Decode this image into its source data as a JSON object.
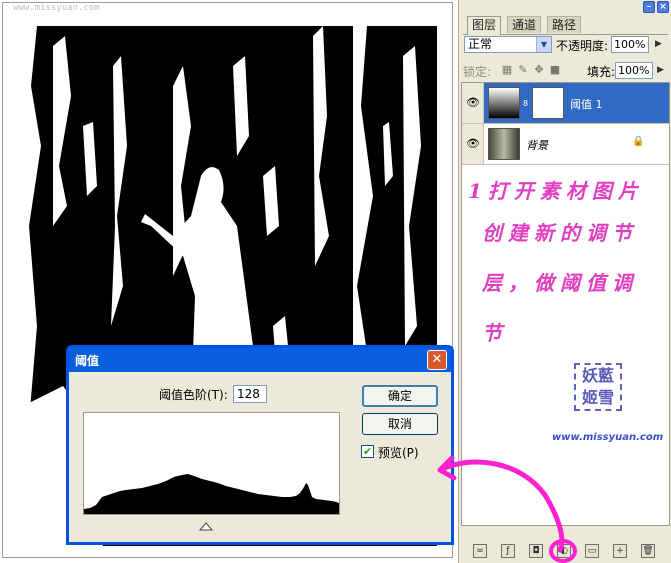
{
  "canvas": {
    "watermark": "www.missyuan.com"
  },
  "layers_panel": {
    "tabs": [
      "图层",
      "通道",
      "路径"
    ],
    "active_tab": 0,
    "blend_mode": "正常",
    "opacity_label": "不透明度:",
    "opacity_value": "100%",
    "lock_label": "锁定:",
    "fill_label": "填充:",
    "fill_value": "100%",
    "layers": [
      {
        "name": "阈值 1",
        "selected": true,
        "icon": "adjustment-layer-thumbnail"
      },
      {
        "name": "背景",
        "selected": false,
        "icon": "background-photo-thumbnail",
        "locked": true
      }
    ],
    "annotation_lines": [
      "1打开素材图片",
      "创建新的调节",
      "层，做阈值调",
      "节"
    ],
    "stamp_text": [
      "妖藍",
      "姬雪"
    ],
    "site_url": "www.missyuan.com",
    "bottom_icons": [
      "link-icon",
      "fx-icon",
      "mask-icon",
      "adjustment-icon",
      "folder-icon",
      "new-layer-icon",
      "trash-icon"
    ]
  },
  "dialog": {
    "title": "阈值",
    "threshold_label": "阈值色阶(T):",
    "threshold_value": "128",
    "ok_label": "确定",
    "cancel_label": "取消",
    "preview_label": "预览(P)",
    "preview_checked": true
  },
  "colors": {
    "selection": "#316ac5",
    "dialog_title": "#0a5fe0",
    "annotation": "#e040c0",
    "arrow": "#ff20d0"
  }
}
